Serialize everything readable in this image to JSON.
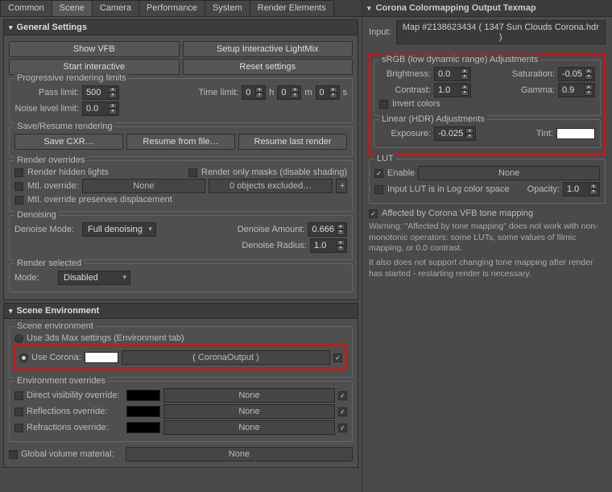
{
  "tabs": [
    "Common",
    "Scene",
    "Camera",
    "Performance",
    "System",
    "Render Elements"
  ],
  "active_tab": "Scene",
  "general": {
    "title": "General Settings",
    "show_vfb": "Show VFB",
    "setup_lightmix": "Setup Interactive LightMix",
    "start_interactive": "Start interactive",
    "reset_settings": "Reset settings",
    "prog_limits_title": "Progressive rendering limits",
    "pass_limit_lbl": "Pass limit:",
    "pass_limit": "500",
    "time_limit_lbl": "Time limit:",
    "time_h": "0",
    "time_m": "0",
    "time_s": "0",
    "h": "h",
    "m": "m",
    "s": "s",
    "noise_lbl": "Noise level limit:",
    "noise": "0.0",
    "save_title": "Save/Resume rendering",
    "save_cxr": "Save CXR…",
    "resume_file": "Resume from file…",
    "resume_last": "Resume last render",
    "overrides_title": "Render overrides",
    "hidden_lights": "Render hidden lights",
    "only_masks": "Render only masks (disable shading)",
    "mtl_override_lbl": "Mtl. override:",
    "mtl_override_slot": "None",
    "objects_excluded": "0 objects excluded…",
    "preserve_disp": "Mtl. override preserves displacement",
    "denoise_title": "Denoising",
    "denoise_mode_lbl": "Denoise Mode:",
    "denoise_mode": "Full denoising",
    "denoise_amount_lbl": "Denoise Amount:",
    "denoise_amount": "0.666",
    "denoise_radius_lbl": "Denoise Radius:",
    "denoise_radius": "1.0",
    "render_sel_title": "Render selected",
    "render_sel_mode_lbl": "Mode:",
    "render_sel_mode": "Disabled"
  },
  "scene_env": {
    "title": "Scene Environment",
    "env_title": "Scene environment",
    "use_max": "Use 3ds Max settings (Environment tab)",
    "use_corona": "Use Corona:",
    "corona_slot": "( CoronaOutput )",
    "env_over_title": "Environment overrides",
    "direct_vis": "Direct visibility override:",
    "reflections": "Reflections override:",
    "refractions": "Refractions override:",
    "none": "None",
    "global_vol": "Global volume material:"
  },
  "right": {
    "title": "Corona Colormapping Output Texmap",
    "input_lbl": "Input:",
    "input_slot": "Map #2138623434  ( 1347 Sun Clouds Corona.hdr )",
    "srgb_title": "sRGB (low dynamic range) Adjustments",
    "brightness_lbl": "Brightness:",
    "brightness": "0.0",
    "saturation_lbl": "Saturation:",
    "saturation": "-0.05",
    "contrast_lbl": "Contrast:",
    "contrast": "1.0",
    "gamma_lbl": "Gamma:",
    "gamma": "0.9",
    "invert": "Invert colors",
    "linear_title": "Linear (HDR) Adjustments",
    "exposure_lbl": "Exposure:",
    "exposure": "-0.025",
    "tint_lbl": "Tint:",
    "lut_title": "LUT",
    "enable": "Enable",
    "lut_slot": "None",
    "log": "Input LUT is in Log color space",
    "opacity_lbl": "Opacity:",
    "opacity": "1.0",
    "affected": "Affected by Corona VFB tone mapping",
    "warn1": "Warning: \"Affected by tone mapping\" does not work with non-monotonic operators: some LUTs, some values of filmic mapping, or 0.0 contrast.",
    "warn2": "It also does not support changing tone mapping after render has started - restarting render is necessary."
  }
}
